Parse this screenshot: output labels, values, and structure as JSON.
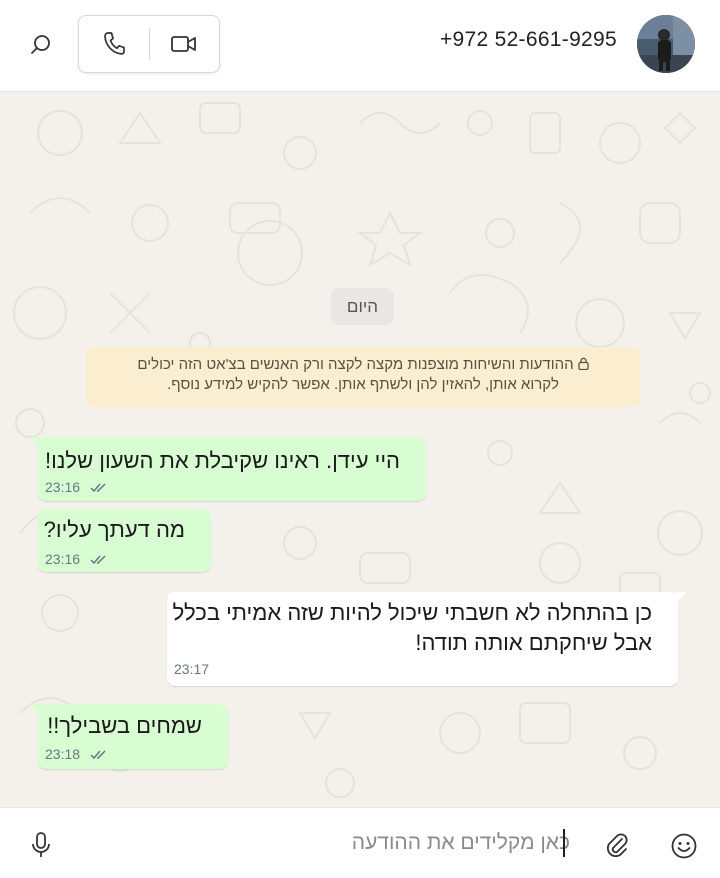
{
  "header": {
    "contact_name": "+972 52-661-9295",
    "icons": [
      "search-icon",
      "phone-icon",
      "video-camera-icon"
    ]
  },
  "chat": {
    "date_chip": "היום",
    "encryption_notice_line1": "ההודעות והשיחות מוצפנות מקצה לקצה ורק האנשים בצ'אט הזה יכולים",
    "encryption_notice_line2": "לקרוא אותן, להאזין להן ולשתף אותן. אפשר להקיש למידע נוסף.",
    "messages": [
      {
        "direction": "outgoing",
        "text": "היי עידן. ראינו שקיבלת את השעון שלנו!",
        "time": "23:16",
        "status": "read"
      },
      {
        "direction": "outgoing",
        "text": "מה דעתך עליו?",
        "time": "23:16",
        "status": "read"
      },
      {
        "direction": "incoming",
        "text_line1": "כן בהתחלה לא חשבתי שיכול להיות שזה אמיתי בכלל",
        "text_line2": "אבל שיחקתם אותה תודה!",
        "time": "23:17"
      },
      {
        "direction": "outgoing",
        "text": "שמחים בשבילך!!",
        "time": "23:18",
        "status": "read"
      }
    ]
  },
  "composer": {
    "placeholder": "כאן מקלידים את ההודעה",
    "value": "",
    "icons": [
      "microphone-icon",
      "paperclip-icon",
      "emoji-icon"
    ]
  },
  "colors": {
    "outgoing_bubble": "#d9fdd3",
    "incoming_bubble": "#ffffff",
    "chat_background": "#f4f1ec",
    "encryption_notice_bg": "#fbedcf",
    "read_ticks": "#667781"
  }
}
